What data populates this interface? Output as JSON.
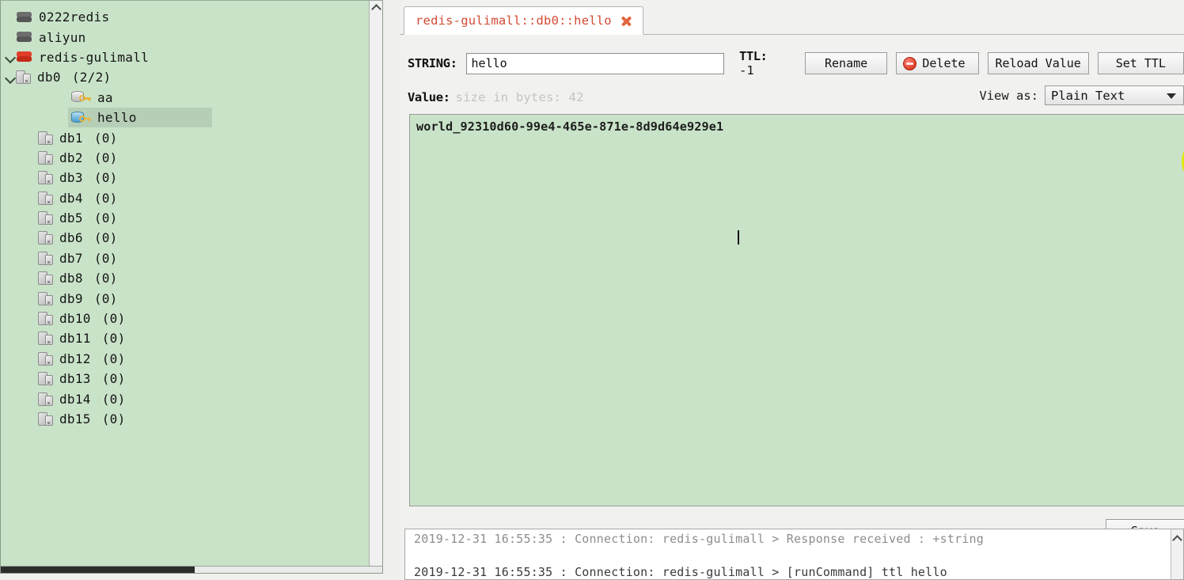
{
  "tree": {
    "items": [
      {
        "label": "0222redis",
        "icon": "server-icon-grey",
        "indent": 0,
        "chevron": "none",
        "count": "",
        "selected": false
      },
      {
        "label": "aliyun",
        "icon": "server-icon-grey",
        "indent": 0,
        "chevron": "none",
        "count": "",
        "selected": false
      },
      {
        "label": "redis-gulimall",
        "icon": "server-icon-red",
        "indent": 0,
        "chevron": "open",
        "count": "",
        "selected": false
      },
      {
        "label": "db0",
        "icon": "database-icon",
        "indent": 1,
        "chevron": "open",
        "count": "(2/2)",
        "selected": false
      },
      {
        "label": "aa",
        "icon": "key-icon-grey",
        "indent": 3,
        "chevron": "none",
        "count": "",
        "selected": false
      },
      {
        "label": "hello",
        "icon": "key-icon-blue",
        "indent": 3,
        "chevron": "none",
        "count": "",
        "selected": true
      },
      {
        "label": "db1",
        "icon": "database-icon",
        "indent": 2,
        "chevron": "none",
        "count": "(0)",
        "selected": false
      },
      {
        "label": "db2",
        "icon": "database-icon",
        "indent": 2,
        "chevron": "none",
        "count": "(0)",
        "selected": false
      },
      {
        "label": "db3",
        "icon": "database-icon",
        "indent": 2,
        "chevron": "none",
        "count": "(0)",
        "selected": false
      },
      {
        "label": "db4",
        "icon": "database-icon",
        "indent": 2,
        "chevron": "none",
        "count": "(0)",
        "selected": false
      },
      {
        "label": "db5",
        "icon": "database-icon",
        "indent": 2,
        "chevron": "none",
        "count": "(0)",
        "selected": false
      },
      {
        "label": "db6",
        "icon": "database-icon",
        "indent": 2,
        "chevron": "none",
        "count": "(0)",
        "selected": false
      },
      {
        "label": "db7",
        "icon": "database-icon",
        "indent": 2,
        "chevron": "none",
        "count": "(0)",
        "selected": false
      },
      {
        "label": "db8",
        "icon": "database-icon",
        "indent": 2,
        "chevron": "none",
        "count": "(0)",
        "selected": false
      },
      {
        "label": "db9",
        "icon": "database-icon",
        "indent": 2,
        "chevron": "none",
        "count": "(0)",
        "selected": false
      },
      {
        "label": "db10",
        "icon": "database-icon",
        "indent": 2,
        "chevron": "none",
        "count": "(0)",
        "selected": false
      },
      {
        "label": "db11",
        "icon": "database-icon",
        "indent": 2,
        "chevron": "none",
        "count": "(0)",
        "selected": false
      },
      {
        "label": "db12",
        "icon": "database-icon",
        "indent": 2,
        "chevron": "none",
        "count": "(0)",
        "selected": false
      },
      {
        "label": "db13",
        "icon": "database-icon",
        "indent": 2,
        "chevron": "none",
        "count": "(0)",
        "selected": false
      },
      {
        "label": "db14",
        "icon": "database-icon",
        "indent": 2,
        "chevron": "none",
        "count": "(0)",
        "selected": false
      },
      {
        "label": "db15",
        "icon": "database-icon",
        "indent": 2,
        "chevron": "none",
        "count": "(0)",
        "selected": false
      }
    ]
  },
  "tab": {
    "title": "redis-gulimall::db0::hello",
    "close_icon": "close-icon",
    "title_color": "#d34b34"
  },
  "key_header": {
    "type_label": "STRING:",
    "key_value": "hello",
    "ttl_label": "TTL:",
    "ttl_value": "-1",
    "buttons": {
      "rename": "Rename",
      "delete": "Delete",
      "reload": "Reload Value",
      "set_ttl": "Set TTL"
    }
  },
  "value_header": {
    "label": "Value:",
    "size_text": "size in bytes: 42",
    "view_as_label": "View as:",
    "view_as_value": "Plain Text",
    "view_as_options": [
      "Plain Text"
    ]
  },
  "value_editor": {
    "text": "world_92310d60-99e4-465e-871e-8d9d64e929e1"
  },
  "save": {
    "label": "Save"
  },
  "log": {
    "lines": [
      "2019-12-31 16:55:35 : Connection: redis-gulimall > Response received : +string",
      "2019-12-31 16:55:35 : Connection: redis-gulimall > [runCommand] ttl hello"
    ]
  },
  "colors": {
    "panel_green": "#c9e3c9",
    "selection_green": "#b6ceb6",
    "tab_red": "#d34b34",
    "highlight_yellow": "#e0e80d",
    "delete_red": "#e0402c"
  }
}
